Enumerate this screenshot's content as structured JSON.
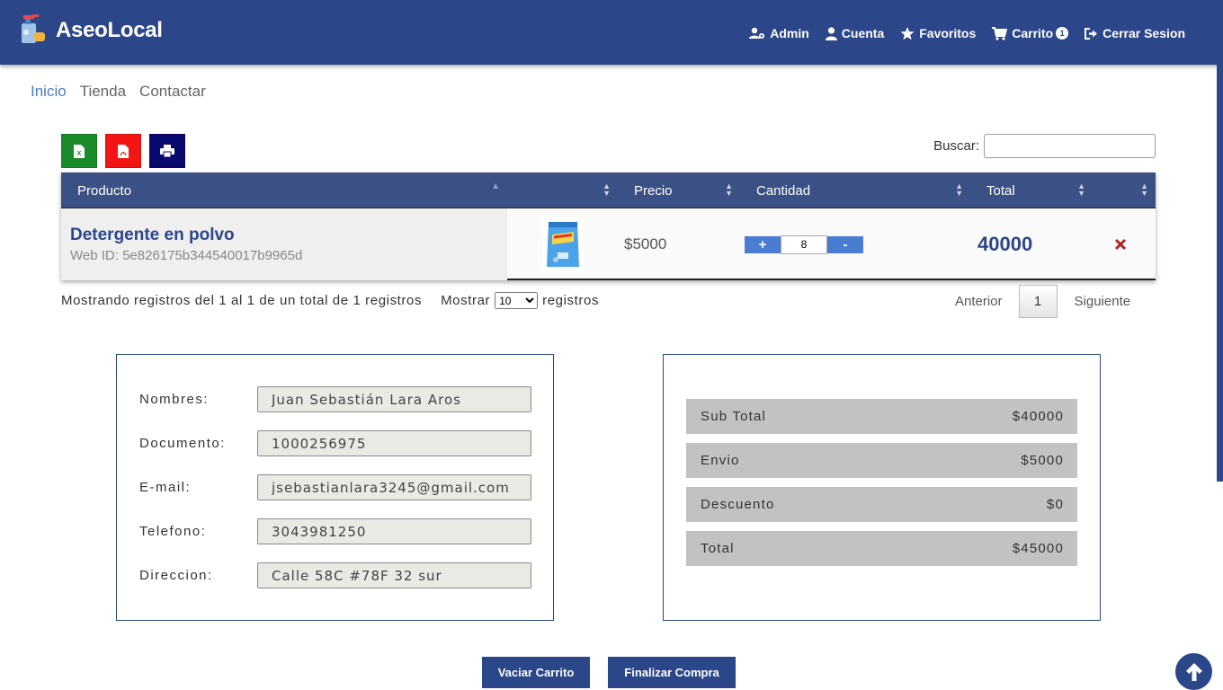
{
  "header": {
    "brand": "AseoLocal",
    "nav": [
      {
        "label": "Admin",
        "icon": "user-gear-icon"
      },
      {
        "label": "Cuenta",
        "icon": "user-icon"
      },
      {
        "label": "Favoritos",
        "icon": "star-icon"
      },
      {
        "label": "Carrito",
        "icon": "cart-icon",
        "badge": "1"
      },
      {
        "label": "Cerrar Sesion",
        "icon": "sign-out-icon"
      }
    ]
  },
  "subnav": {
    "items": [
      "Inicio",
      "Tienda",
      "Contactar"
    ],
    "active": "Inicio"
  },
  "toolbar": {
    "search_label": "Buscar:",
    "search_value": ""
  },
  "table": {
    "columns": [
      "Producto",
      "",
      "Precio",
      "Cantidad",
      "Total",
      ""
    ],
    "rows": [
      {
        "name": "Detergente en polvo",
        "web_id": "Web ID: 5e826175b344540017b9965d",
        "price": "$5000",
        "quantity": "8",
        "total": "40000"
      }
    ],
    "qty_plus": "+",
    "qty_minus": "-",
    "info_prefix": "Mostrando registros del 1 al 1 de un total de 1 registros",
    "show_label": "Mostrar",
    "show_value": "10",
    "show_suffix": "registros",
    "pager": {
      "prev": "Anterior",
      "page": "1",
      "next": "Siguiente"
    }
  },
  "client": {
    "fields": [
      {
        "label": "Nombres:",
        "value": "Juan Sebastián Lara Aros"
      },
      {
        "label": "Documento:",
        "value": "1000256975"
      },
      {
        "label": "E-mail:",
        "value": "jsebastianlara3245@gmail.com"
      },
      {
        "label": "Telefono:",
        "value": "3043981250"
      },
      {
        "label": "Direccion:",
        "value": "Calle 58C #78F 32 sur"
      }
    ]
  },
  "summary": {
    "rows": [
      {
        "label": "Sub Total",
        "value": "$40000"
      },
      {
        "label": "Envio",
        "value": "$5000"
      },
      {
        "label": "Descuento",
        "value": "$0"
      },
      {
        "label": "Total",
        "value": "$45000"
      }
    ]
  },
  "actions": {
    "empty_cart": "Vaciar Carrito",
    "finish": "Finalizar Compra"
  },
  "colors": {
    "primary": "#2b4689",
    "table_header": "#3b5084",
    "excel": "#1a8a2a",
    "pdf": "#f41414",
    "print": "#0a0a6e",
    "delete": "#b0242a"
  }
}
